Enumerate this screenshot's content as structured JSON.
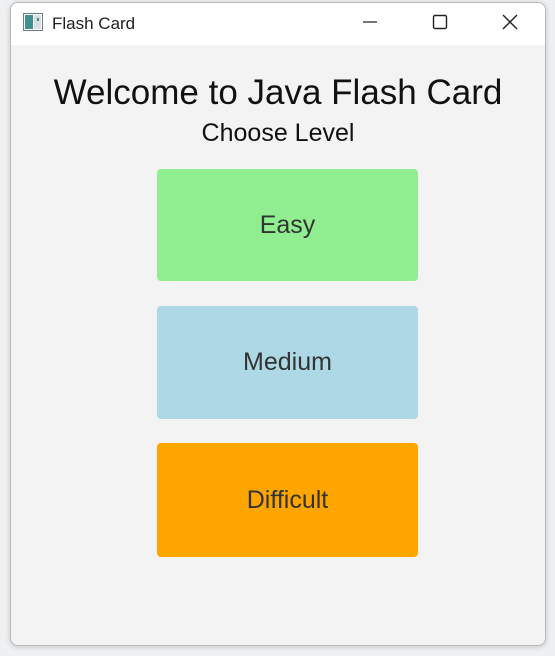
{
  "window": {
    "title": "Flash Card",
    "controls": {
      "minimize_icon": "minimize-icon",
      "maximize_icon": "maximize-icon",
      "close_icon": "close-icon"
    }
  },
  "main": {
    "heading": "Welcome to Java Flash Card",
    "subheading": "Choose Level",
    "levels": [
      {
        "label": "Easy",
        "color": "#90ee90"
      },
      {
        "label": "Medium",
        "color": "#add8e6"
      },
      {
        "label": "Difficult",
        "color": "#ffa500"
      }
    ]
  },
  "colors": {
    "titlebar": "#ffffff",
    "content_background": "#f3f3f3",
    "heading_text": "#111111",
    "button_text": "#333333"
  }
}
